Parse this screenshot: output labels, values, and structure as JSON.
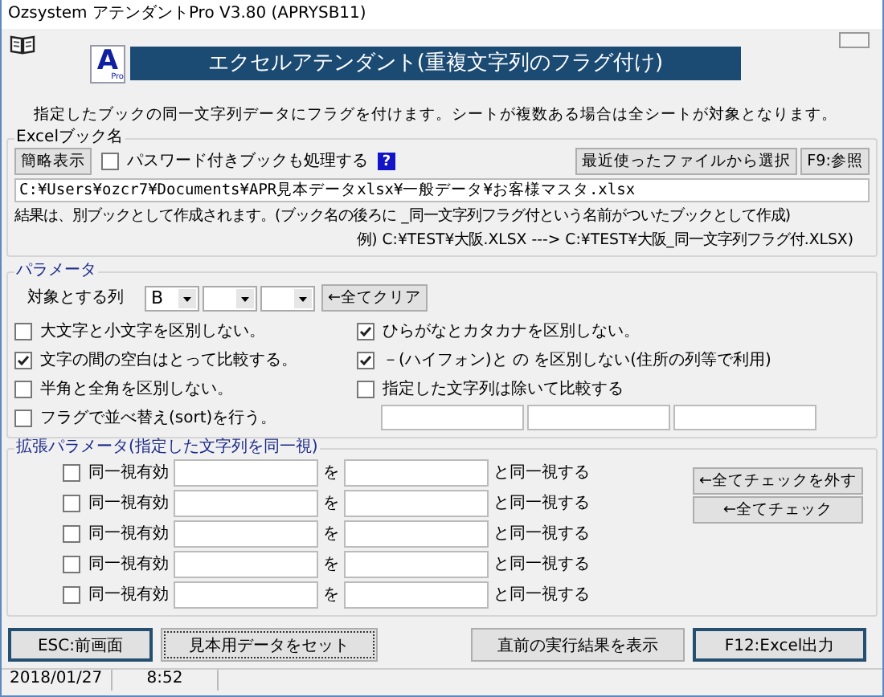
{
  "window": {
    "title": "Ozsystem アテンダントPro V3.80 (APRYSB11)"
  },
  "banner": {
    "logo_letter": "A",
    "logo_sub": "Pro",
    "title": "エクセルアテンダント(重複文字列のフラグ付け)"
  },
  "description": "指定したブックの同一文字列データにフラグを付けます。シートが複数ある場合は全シートが対象となります。",
  "excel_book": {
    "legend": "Excelブック名",
    "summary_button": "簡略表示",
    "password_option": {
      "label": "パスワード付きブックも処理する",
      "checked": false
    },
    "help_badge": "?",
    "recent_button": "最近使ったファイルから選択",
    "browse_button": "F9:参照",
    "path": "C:¥Users¥ozcr7¥Documents¥APR見本データxlsx¥一般データ¥お客様マスタ.xlsx",
    "result_note": "結果は、別ブックとして作成されます。(ブック名の後ろに _同一文字列フラグ付という名前がついたブックとして作成)",
    "example": "例) C:¥TEST¥大阪.XLSX ---> C:¥TEST¥大阪_同一文字列フラグ付.XLSX)"
  },
  "parameters": {
    "legend": "パラメータ",
    "column_label": "対象とする列",
    "column_selects": [
      "B"
    ],
    "clear_button": "←全てクリア",
    "left_options": [
      {
        "label": "大文字と小文字を区別しない。",
        "checked": false
      },
      {
        "label": "文字の間の空白はとって比較する。",
        "checked": true
      },
      {
        "label": "半角と全角を区別しない。",
        "checked": false
      },
      {
        "label": "フラグで並べ替え(sort)を行う。",
        "checked": false
      }
    ],
    "right_options": [
      {
        "label": "ひらがなとカタカナを区別しない。",
        "checked": true
      },
      {
        "label": "－(ハイフォン)と の を区別しない(住所の列等で利用)",
        "checked": true
      },
      {
        "label": "指定した文字列は除いて比較する",
        "checked": false
      }
    ]
  },
  "extended": {
    "legend": "拡張パラメータ(指定した文字列を同一視)",
    "rows": [
      {
        "label": "同一視有効",
        "checked": false,
        "connector": "を",
        "suffix": "と同一視する"
      },
      {
        "label": "同一視有効",
        "checked": false,
        "connector": "を",
        "suffix": "と同一視する"
      },
      {
        "label": "同一視有効",
        "checked": false,
        "connector": "を",
        "suffix": "と同一視する"
      },
      {
        "label": "同一視有効",
        "checked": false,
        "connector": "を",
        "suffix": "と同一視する"
      },
      {
        "label": "同一視有効",
        "checked": false,
        "connector": "を",
        "suffix": "と同一視する"
      }
    ],
    "uncheck_all_button": "←全てチェックを外す",
    "check_all_button": "←全てチェック"
  },
  "footer_buttons": [
    {
      "label": "ESC:前画面",
      "kind": "default"
    },
    {
      "label": "見本用データをセット",
      "kind": "focused"
    },
    {
      "label": "直前の実行結果を表示",
      "kind": "normal"
    },
    {
      "label": "F12:Excel出力",
      "kind": "default"
    }
  ],
  "status_bar": [
    "2018/01/27",
    "8:52"
  ]
}
